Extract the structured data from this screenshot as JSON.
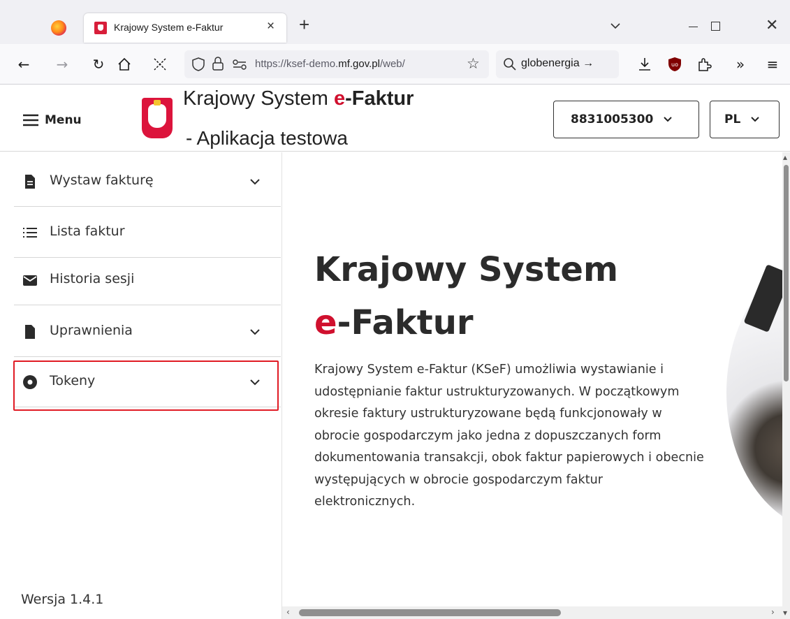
{
  "browser": {
    "tab_title": "Krajowy System e-Faktur",
    "tab_close": "×",
    "new_tab": "+",
    "url_prefix": "https://ksef-demo.",
    "url_domain": "mf.gov.pl",
    "url_suffix": "/web/",
    "search_text": "globenergia →"
  },
  "header": {
    "menu_label": "Menu",
    "title_plain": "Krajowy System",
    "title_accent_e": "e",
    "title_accent_rest": "-Faktur",
    "subtitle": "- Aplikacja testowa",
    "context_nip": "8831005300",
    "language": "PL"
  },
  "sidebar": {
    "items": [
      {
        "label": "Wystaw fakturę",
        "icon": "document-icon",
        "expandable": true
      },
      {
        "label": "Lista faktur",
        "icon": "list-icon",
        "expandable": false
      },
      {
        "label": "Historia sesji",
        "icon": "envelope-icon",
        "expandable": false
      },
      {
        "label": "Uprawnienia",
        "icon": "file-icon",
        "expandable": true
      },
      {
        "label": "Tokeny",
        "icon": "token-icon",
        "expandable": true
      }
    ],
    "version": "Wersja 1.4.1"
  },
  "main": {
    "hero_line1": "Krajowy System",
    "hero_accent_e": "e",
    "hero_line2_rest": "-Faktur",
    "hero_text": "Krajowy System e-Faktur (KSeF) umożliwia wystawianie i udostępnianie faktur ustrukturyzowanych. W początkowym okresie faktury ustrukturyzowane będą funkcjonowały w obrocie gospodarczym jako jedna z dopuszczanych form dokumentowania transakcji, obok faktur papierowych i obecnie występujących w obrocie gospodarczym faktur elektronicznych."
  },
  "colors": {
    "accent": "#d0102e",
    "highlight_box": "#e01b24"
  }
}
